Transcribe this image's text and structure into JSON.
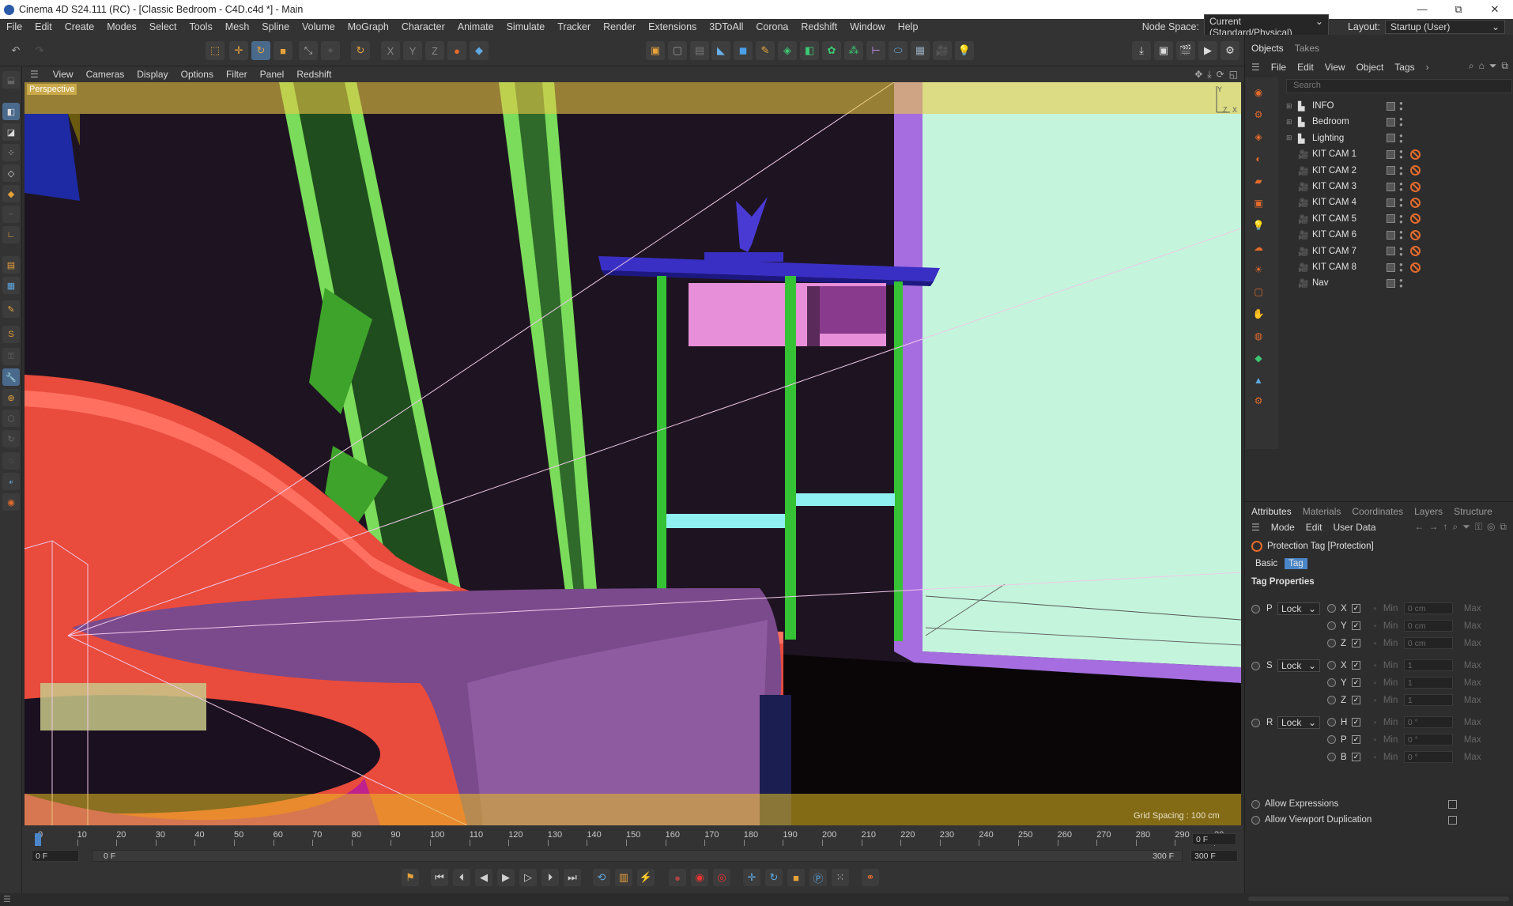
{
  "window": {
    "title": "Cinema 4D S24.111 (RC) - [Classic Bedroom - C4D.c4d *] - Main",
    "min": "—",
    "max": "⧉",
    "close": "✕"
  },
  "menubar": {
    "items": [
      "File",
      "Edit",
      "Create",
      "Modes",
      "Select",
      "Tools",
      "Mesh",
      "Spline",
      "Volume",
      "MoGraph",
      "Character",
      "Animate",
      "Simulate",
      "Tracker",
      "Render",
      "Extensions",
      "3DToAll",
      "Corona",
      "Redshift",
      "Window",
      "Help"
    ],
    "node_space_label": "Node Space:",
    "node_space_value": "Current (Standard/Physical)",
    "layout_label": "Layout:",
    "layout_value": "Startup (User)"
  },
  "viewport": {
    "menu": [
      "View",
      "Cameras",
      "Display",
      "Options",
      "Filter",
      "Panel",
      "Redshift"
    ],
    "label": "Perspective",
    "grid_spacing": "Grid Spacing : 100 cm",
    "axis_x": "X",
    "axis_y": "Y",
    "axis_z": "Z"
  },
  "timeline": {
    "ticks": [
      "0",
      "10",
      "20",
      "30",
      "40",
      "50",
      "60",
      "70",
      "80",
      "90",
      "100",
      "110",
      "120",
      "130",
      "140",
      "150",
      "160",
      "170",
      "180",
      "190",
      "200",
      "210",
      "220",
      "230",
      "240",
      "250",
      "260",
      "270",
      "280",
      "290",
      "30"
    ],
    "current_frame": "0 F",
    "start_field": "0 F",
    "range_start": "0 F",
    "range_end": "300 F",
    "end_field": "300 F"
  },
  "objects_panel": {
    "tabs": [
      "Objects",
      "Takes"
    ],
    "menu": [
      "File",
      "Edit",
      "View",
      "Object",
      "Tags"
    ],
    "search_placeholder": "Search",
    "items": [
      {
        "name": "INFO",
        "type": "layer",
        "tag": false
      },
      {
        "name": "Bedroom",
        "type": "layer",
        "tag": false
      },
      {
        "name": "Lighting",
        "type": "layer",
        "tag": false
      },
      {
        "name": "KIT CAM 1",
        "type": "camera",
        "tag": true
      },
      {
        "name": "KIT CAM 2",
        "type": "camera",
        "tag": true
      },
      {
        "name": "KIT CAM 3",
        "type": "camera",
        "tag": true
      },
      {
        "name": "KIT CAM 4",
        "type": "camera",
        "tag": true
      },
      {
        "name": "KIT CAM 5",
        "type": "camera",
        "tag": true
      },
      {
        "name": "KIT CAM 6",
        "type": "camera",
        "tag": true
      },
      {
        "name": "KIT CAM 7",
        "type": "camera",
        "tag": true
      },
      {
        "name": "KIT CAM 8",
        "type": "camera",
        "tag": true
      },
      {
        "name": "Nav",
        "type": "camera",
        "tag": false
      }
    ]
  },
  "attributes_panel": {
    "tabs": [
      "Attributes",
      "Materials",
      "Coordinates",
      "Layers",
      "Structure"
    ],
    "menu": [
      "Mode",
      "Edit",
      "User Data"
    ],
    "header": "Protection Tag [Protection]",
    "subtabs": [
      "Basic",
      "Tag"
    ],
    "section": "Tag Properties",
    "groups": [
      {
        "label": "P",
        "mode": "Lock",
        "axes": [
          {
            "axis": "X",
            "min": "0 cm"
          },
          {
            "axis": "Y",
            "min": "0 cm"
          },
          {
            "axis": "Z",
            "min": "0 cm"
          }
        ]
      },
      {
        "label": "S",
        "mode": "Lock",
        "axes": [
          {
            "axis": "X",
            "min": "1"
          },
          {
            "axis": "Y",
            "min": "1"
          },
          {
            "axis": "Z",
            "min": "1"
          }
        ]
      },
      {
        "label": "R",
        "mode": "Lock",
        "axes": [
          {
            "axis": "H",
            "min": "0 °"
          },
          {
            "axis": "P",
            "min": "0 °"
          },
          {
            "axis": "B",
            "min": "0 °"
          }
        ]
      }
    ],
    "min_label": "Min",
    "max_label": "Max",
    "allow_expressions": "Allow Expressions",
    "allow_viewport_duplication": "Allow Viewport Duplication"
  },
  "colors": {
    "accent": "#e36b2c",
    "tab_active": "#4a86c8",
    "viewport_bg": "#1e1421",
    "safe_frame": "#c9a94a"
  }
}
